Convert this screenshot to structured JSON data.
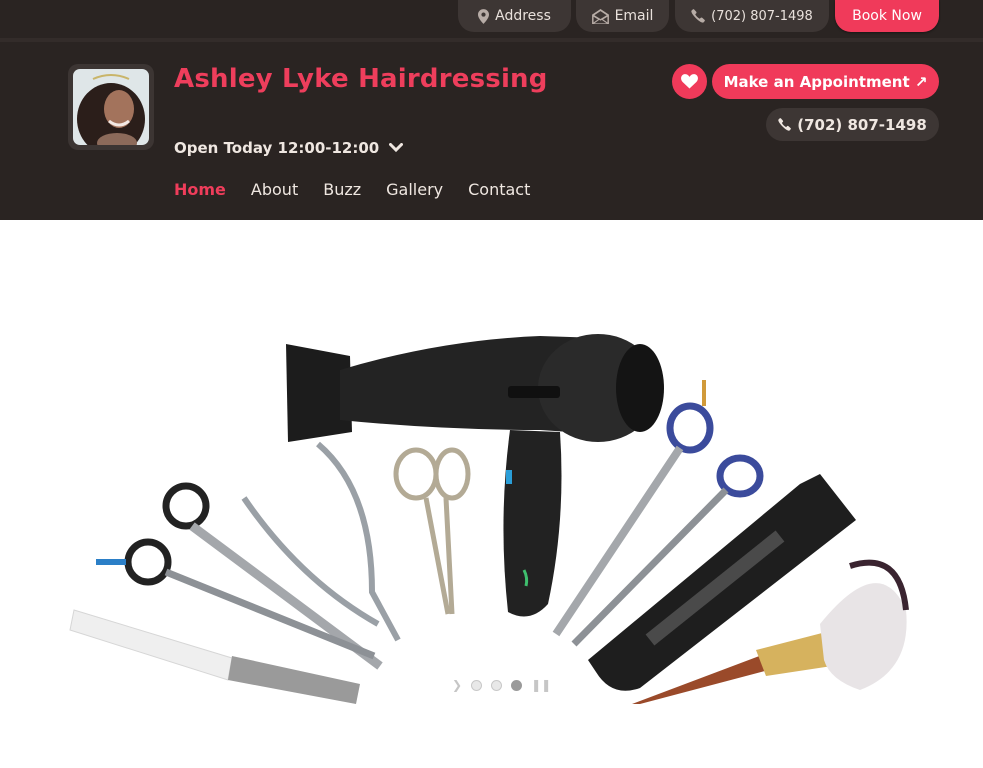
{
  "topbar": {
    "address_label": "Address",
    "email_label": "Email",
    "phone_label": "(702) 807-1498",
    "book_label": "Book Now"
  },
  "header": {
    "title": "Ashley Lyke Hairdressing",
    "hours_label": "Open Today 12:00-12:00",
    "appointment_label": "Make an Appointment ↗",
    "phone_label": "(702) 807-1498"
  },
  "nav": {
    "items": [
      {
        "label": "Home",
        "active": true
      },
      {
        "label": "About",
        "active": false
      },
      {
        "label": "Buzz",
        "active": false
      },
      {
        "label": "Gallery",
        "active": false
      },
      {
        "label": "Contact",
        "active": false
      }
    ]
  },
  "slider": {
    "slide_count": 3,
    "active_index": 2
  },
  "colors": {
    "accent": "#f03a5a",
    "header_bg": "#2a2422",
    "pill_bg": "#3d3634",
    "text_light": "#efe7e1"
  },
  "icons": {
    "address": "map-pin-icon",
    "email": "envelope-icon",
    "phone": "phone-icon",
    "favorite": "heart-icon",
    "hours_toggle": "chevron-down-icon"
  }
}
